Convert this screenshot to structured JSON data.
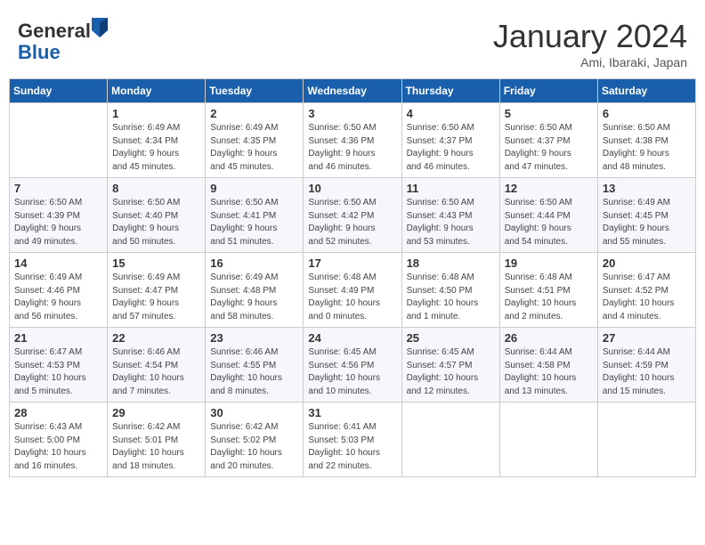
{
  "header": {
    "logo_general": "General",
    "logo_blue": "Blue",
    "month_title": "January 2024",
    "location": "Ami, Ibaraki, Japan"
  },
  "days_of_week": [
    "Sunday",
    "Monday",
    "Tuesday",
    "Wednesday",
    "Thursday",
    "Friday",
    "Saturday"
  ],
  "weeks": [
    [
      {
        "day": "",
        "info": ""
      },
      {
        "day": "1",
        "info": "Sunrise: 6:49 AM\nSunset: 4:34 PM\nDaylight: 9 hours\nand 45 minutes."
      },
      {
        "day": "2",
        "info": "Sunrise: 6:49 AM\nSunset: 4:35 PM\nDaylight: 9 hours\nand 45 minutes."
      },
      {
        "day": "3",
        "info": "Sunrise: 6:50 AM\nSunset: 4:36 PM\nDaylight: 9 hours\nand 46 minutes."
      },
      {
        "day": "4",
        "info": "Sunrise: 6:50 AM\nSunset: 4:37 PM\nDaylight: 9 hours\nand 46 minutes."
      },
      {
        "day": "5",
        "info": "Sunrise: 6:50 AM\nSunset: 4:37 PM\nDaylight: 9 hours\nand 47 minutes."
      },
      {
        "day": "6",
        "info": "Sunrise: 6:50 AM\nSunset: 4:38 PM\nDaylight: 9 hours\nand 48 minutes."
      }
    ],
    [
      {
        "day": "7",
        "info": "Sunrise: 6:50 AM\nSunset: 4:39 PM\nDaylight: 9 hours\nand 49 minutes."
      },
      {
        "day": "8",
        "info": "Sunrise: 6:50 AM\nSunset: 4:40 PM\nDaylight: 9 hours\nand 50 minutes."
      },
      {
        "day": "9",
        "info": "Sunrise: 6:50 AM\nSunset: 4:41 PM\nDaylight: 9 hours\nand 51 minutes."
      },
      {
        "day": "10",
        "info": "Sunrise: 6:50 AM\nSunset: 4:42 PM\nDaylight: 9 hours\nand 52 minutes."
      },
      {
        "day": "11",
        "info": "Sunrise: 6:50 AM\nSunset: 4:43 PM\nDaylight: 9 hours\nand 53 minutes."
      },
      {
        "day": "12",
        "info": "Sunrise: 6:50 AM\nSunset: 4:44 PM\nDaylight: 9 hours\nand 54 minutes."
      },
      {
        "day": "13",
        "info": "Sunrise: 6:49 AM\nSunset: 4:45 PM\nDaylight: 9 hours\nand 55 minutes."
      }
    ],
    [
      {
        "day": "14",
        "info": "Sunrise: 6:49 AM\nSunset: 4:46 PM\nDaylight: 9 hours\nand 56 minutes."
      },
      {
        "day": "15",
        "info": "Sunrise: 6:49 AM\nSunset: 4:47 PM\nDaylight: 9 hours\nand 57 minutes."
      },
      {
        "day": "16",
        "info": "Sunrise: 6:49 AM\nSunset: 4:48 PM\nDaylight: 9 hours\nand 58 minutes."
      },
      {
        "day": "17",
        "info": "Sunrise: 6:48 AM\nSunset: 4:49 PM\nDaylight: 10 hours\nand 0 minutes."
      },
      {
        "day": "18",
        "info": "Sunrise: 6:48 AM\nSunset: 4:50 PM\nDaylight: 10 hours\nand 1 minute."
      },
      {
        "day": "19",
        "info": "Sunrise: 6:48 AM\nSunset: 4:51 PM\nDaylight: 10 hours\nand 2 minutes."
      },
      {
        "day": "20",
        "info": "Sunrise: 6:47 AM\nSunset: 4:52 PM\nDaylight: 10 hours\nand 4 minutes."
      }
    ],
    [
      {
        "day": "21",
        "info": "Sunrise: 6:47 AM\nSunset: 4:53 PM\nDaylight: 10 hours\nand 5 minutes."
      },
      {
        "day": "22",
        "info": "Sunrise: 6:46 AM\nSunset: 4:54 PM\nDaylight: 10 hours\nand 7 minutes."
      },
      {
        "day": "23",
        "info": "Sunrise: 6:46 AM\nSunset: 4:55 PM\nDaylight: 10 hours\nand 8 minutes."
      },
      {
        "day": "24",
        "info": "Sunrise: 6:45 AM\nSunset: 4:56 PM\nDaylight: 10 hours\nand 10 minutes."
      },
      {
        "day": "25",
        "info": "Sunrise: 6:45 AM\nSunset: 4:57 PM\nDaylight: 10 hours\nand 12 minutes."
      },
      {
        "day": "26",
        "info": "Sunrise: 6:44 AM\nSunset: 4:58 PM\nDaylight: 10 hours\nand 13 minutes."
      },
      {
        "day": "27",
        "info": "Sunrise: 6:44 AM\nSunset: 4:59 PM\nDaylight: 10 hours\nand 15 minutes."
      }
    ],
    [
      {
        "day": "28",
        "info": "Sunrise: 6:43 AM\nSunset: 5:00 PM\nDaylight: 10 hours\nand 16 minutes."
      },
      {
        "day": "29",
        "info": "Sunrise: 6:42 AM\nSunset: 5:01 PM\nDaylight: 10 hours\nand 18 minutes."
      },
      {
        "day": "30",
        "info": "Sunrise: 6:42 AM\nSunset: 5:02 PM\nDaylight: 10 hours\nand 20 minutes."
      },
      {
        "day": "31",
        "info": "Sunrise: 6:41 AM\nSunset: 5:03 PM\nDaylight: 10 hours\nand 22 minutes."
      },
      {
        "day": "",
        "info": ""
      },
      {
        "day": "",
        "info": ""
      },
      {
        "day": "",
        "info": ""
      }
    ]
  ]
}
